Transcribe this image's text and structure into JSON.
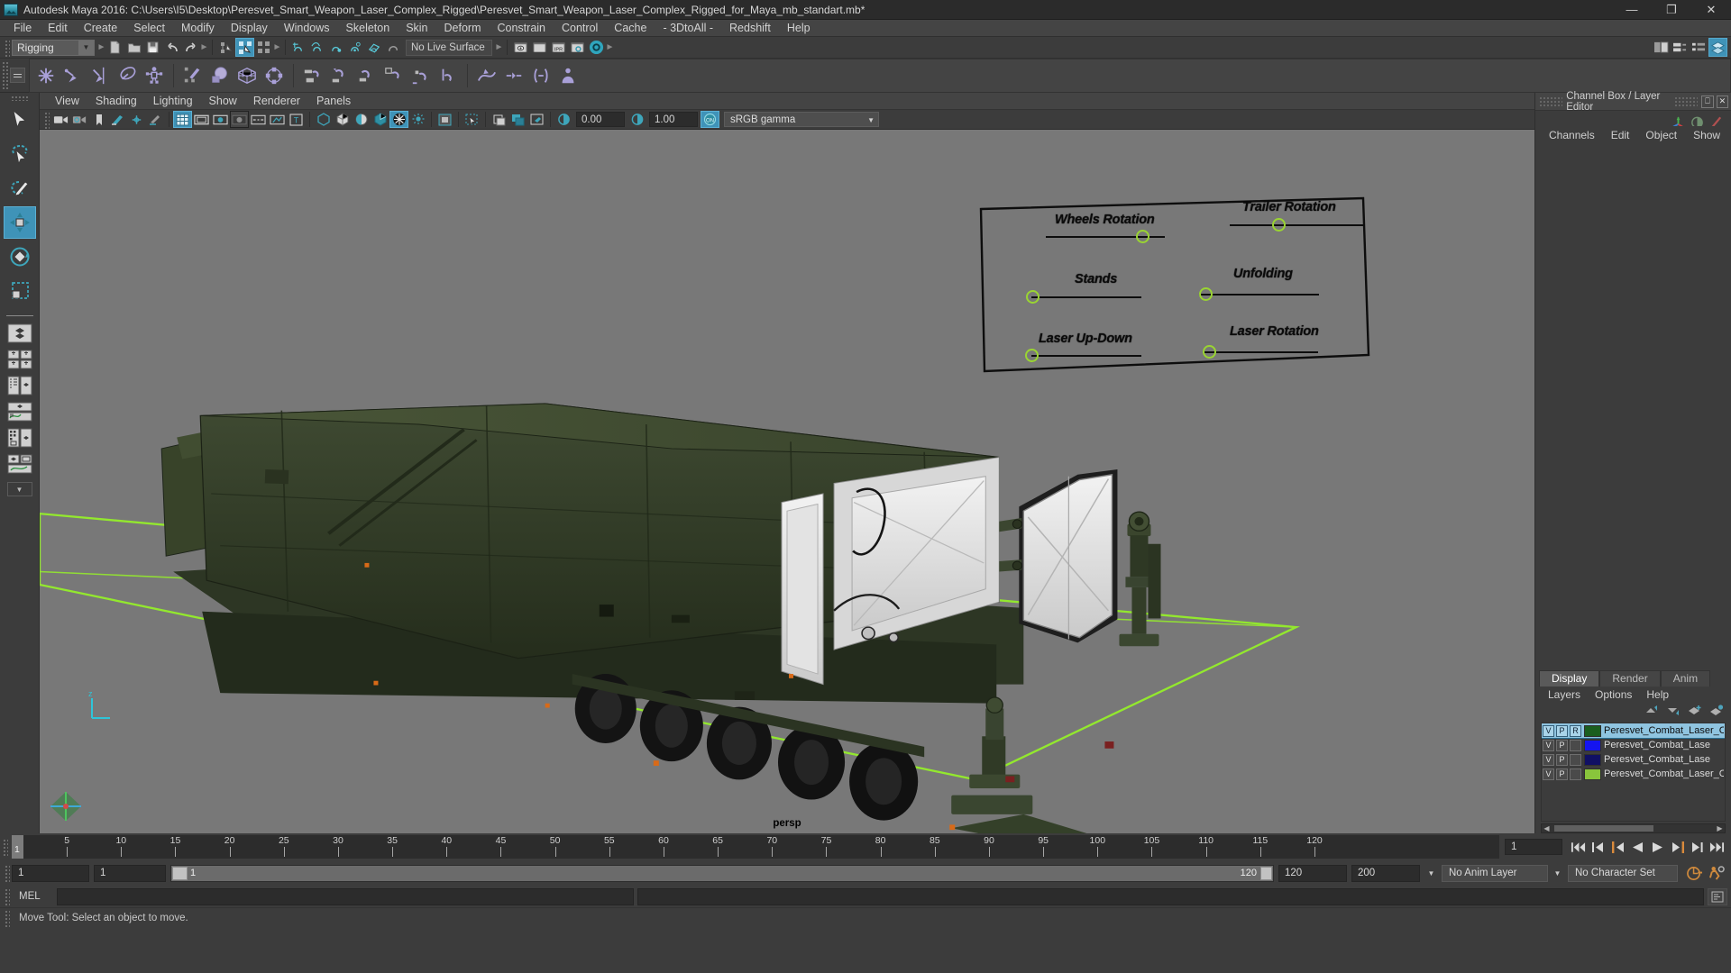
{
  "window": {
    "title": "Autodesk Maya 2016: C:\\Users\\I5\\Desktop\\Peresvet_Smart_Weapon_Laser_Complex_Rigged\\Peresvet_Smart_Weapon_Laser_Complex_Rigged_for_Maya_mb_standart.mb*",
    "minimize": "—",
    "maximize": "❐",
    "close": "✕"
  },
  "menubar": {
    "items": [
      "File",
      "Edit",
      "Create",
      "Select",
      "Modify",
      "Display",
      "Windows",
      "Skeleton",
      "Skin",
      "Deform",
      "Constrain",
      "Control",
      "Cache",
      "- 3DtoAll -",
      "Redshift",
      "Help"
    ]
  },
  "statusline": {
    "menu_set": "Rigging",
    "live_surface": "No Live Surface",
    "icons": [
      "new-scene-icon",
      "open-scene-icon",
      "save-scene-icon",
      "undo-icon",
      "redo-icon",
      "select-hierarchy-icon",
      "select-object-icon",
      "select-component-icon",
      "snap-grid-icon",
      "snap-curve-icon",
      "snap-point-icon",
      "snap-projected-center-icon",
      "snap-view-plane-icon",
      "make-live-icon",
      "render-view-icon",
      "render-current-frame-icon",
      "ipr-render-icon",
      "render-settings-icon",
      "redshift-render-icon"
    ],
    "right_icons": [
      "show-hide-editors-icon",
      "attribute-editor-icon",
      "tool-settings-icon",
      "channel-box-layer-editor-icon"
    ]
  },
  "shelf": {
    "active_tab": "Rigging",
    "icons": [
      "create-joint-icon",
      "ik-handle-icon",
      "ik-spline-handle-icon",
      "insert-joint-icon",
      "quick-rig-icon",
      "paint-skin-weights-icon",
      "bind-skin-icon",
      "lattice-deformer-icon",
      "cluster-deformer-icon",
      "parent-constraint-icon",
      "point-constraint-icon",
      "orient-constraint-icon",
      "scale-constraint-icon",
      "aim-constraint-icon",
      "pole-vector-icon",
      "motion-path-icon",
      "set-driven-key-icon",
      "expression-icon",
      "character-set-icon"
    ]
  },
  "toolbox": {
    "tools": [
      {
        "name": "select-tool",
        "active": false
      },
      {
        "name": "lasso-select-tool",
        "active": false
      },
      {
        "name": "paint-select-tool",
        "active": false
      },
      {
        "name": "move-tool",
        "active": true
      },
      {
        "name": "rotate-tool",
        "active": false
      },
      {
        "name": "scale-tool",
        "active": false
      }
    ],
    "layouts": [
      "single-perspective-layout",
      "four-view-layout",
      "outliner-persp-layout",
      "persp-graph-layout",
      "hypershade-persp-layout",
      "persp-graph-outliner-layout"
    ]
  },
  "viewport": {
    "menus": [
      "View",
      "Shading",
      "Lighting",
      "Show",
      "Renderer",
      "Panels"
    ],
    "camera_label": "persp",
    "exposure": "0.00",
    "gamma": "1.00",
    "color_management": "sRGB gamma",
    "toolbar_icons": [
      "select-camera-icon",
      "camera-attributes-icon",
      "bookmark-icon",
      "image-plane-icon",
      "two-sided-lighting-icon",
      "shadows-icon",
      "grid-icon",
      "film-gate-icon",
      "resolution-gate-icon",
      "gate-mask-icon",
      "exposure-icon",
      "xray-icon",
      "texture-icon",
      "wireframe-icon",
      "smooth-shade-icon",
      "smooth-shade-all-icon",
      "flat-shade-icon",
      "shaded-wireframe-icon",
      "textured-icon",
      "use-default-light-icon"
    ]
  },
  "rig_panel": {
    "controls": [
      {
        "label": "Wheels Rotation",
        "knob_pct": 78
      },
      {
        "label": "Trailer Rotation",
        "knob_pct": 37
      },
      {
        "label": "Stands",
        "knob_pct": 6
      },
      {
        "label": "Unfolding",
        "knob_pct": 8
      },
      {
        "label": "Laser Up-Down",
        "knob_pct": 6
      },
      {
        "label": "Laser Rotation",
        "knob_pct": 10
      }
    ],
    "accent_color": "#9ad432",
    "line_color": "#0d0d0d"
  },
  "channel_box": {
    "panel_title": "Channel Box / Layer Editor",
    "menus": [
      "Channels",
      "Edit",
      "Object",
      "Show"
    ],
    "header_icons": [
      "undock-icon",
      "close-icon"
    ],
    "side_icons": [
      "channel-box-icon",
      "attribute-editor-icon",
      "modeling-toolkit-icon"
    ]
  },
  "layer_editor": {
    "tabs": [
      "Display",
      "Render",
      "Anim"
    ],
    "active_tab": "Display",
    "menus": [
      "Layers",
      "Options",
      "Help"
    ],
    "tool_icons": [
      "move-layer-up-icon",
      "move-layer-down-icon",
      "new-layer-icon",
      "new-layer-from-selected-icon"
    ],
    "layers": [
      {
        "visibility": "V",
        "playback": "P",
        "reference": "R",
        "color": "#1a5e1f",
        "name": "Peresvet_Combat_Laser_Com",
        "selected": true
      },
      {
        "visibility": "V",
        "playback": "P",
        "reference": "",
        "color": "#1414f0",
        "name": "Peresvet_Combat_Lase",
        "selected": false
      },
      {
        "visibility": "V",
        "playback": "P",
        "reference": "",
        "color": "#101064",
        "name": "Peresvet_Combat_Lase",
        "selected": false
      },
      {
        "visibility": "V",
        "playback": "P",
        "reference": "",
        "color": "#89c53c",
        "name": "Peresvet_Combat_Laser_C",
        "selected": false
      }
    ]
  },
  "time_slider": {
    "current_frame": "1",
    "start": 1,
    "end": 120,
    "tick_labels": [
      5,
      10,
      15,
      20,
      25,
      30,
      35,
      40,
      45,
      50,
      55,
      60,
      65,
      70,
      75,
      80,
      85,
      90,
      95,
      100,
      105,
      110,
      115,
      120
    ],
    "current_frame_field": "1",
    "playback_icons": [
      "go-to-start-icon",
      "step-back-keyframe-icon",
      "step-back-frame-icon",
      "play-backwards-icon",
      "play-forwards-icon",
      "step-forward-frame-icon",
      "step-forward-keyframe-icon",
      "go-to-end-icon"
    ]
  },
  "range_slider": {
    "anim_start": "1",
    "range_start": "1",
    "bar_start_value": "1",
    "bar_end_value": "120",
    "range_end": "120",
    "anim_end": "200",
    "anim_layer": "No Anim Layer",
    "character_set": "No Character Set",
    "right_icons": [
      "auto-key-icon",
      "animation-preferences-icon"
    ]
  },
  "command_line": {
    "language": "MEL",
    "input_value": "",
    "output_value": "",
    "script-editor-icon": "script-editor-icon"
  },
  "help_line": {
    "message": "Move Tool: Select an object to move."
  }
}
